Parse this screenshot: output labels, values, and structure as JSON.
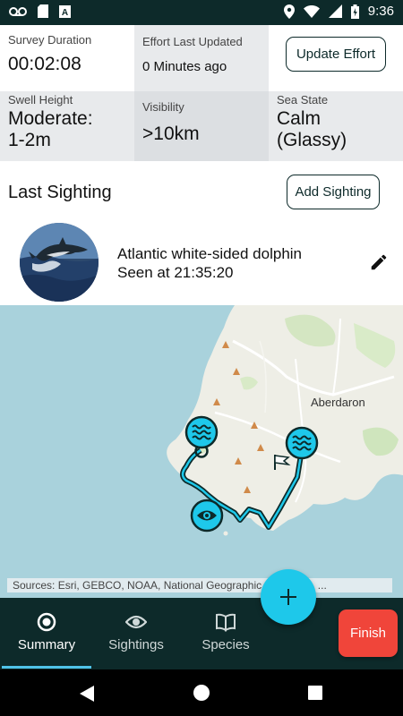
{
  "status_bar": {
    "time": "9:36",
    "left_icons": [
      "voicemail-icon",
      "sd-card-icon",
      "app-notification-icon"
    ],
    "right_icons": [
      "location-icon",
      "wifi-icon",
      "signal-icon",
      "battery-icon"
    ]
  },
  "survey": {
    "duration_label": "Survey Duration",
    "duration_value": "00:02:08",
    "effort_label": "Effort Last Updated",
    "effort_value": "0 Minutes ago",
    "update_button": "Update Effort",
    "swell_label": "Swell Height",
    "swell_value_line1": "Moderate:",
    "swell_value_line2": "1-2m",
    "visibility_label": "Visibility",
    "visibility_value": ">10km",
    "sea_state_label": "Sea State",
    "sea_state_value_line1": "Calm",
    "sea_state_value_line2": "(Glassy)"
  },
  "last_sighting": {
    "title": "Last Sighting",
    "add_button": "Add Sighting",
    "species": "Atlantic white-sided dolphin",
    "seen_at": "Seen at 21:35:20"
  },
  "map": {
    "place_label": "Aberdaron",
    "attribution": "Sources: Esri, GEBCO, NOAA, National Geographic, DeLorme, ..."
  },
  "nav": {
    "items": [
      {
        "label": "Summary",
        "icon": "radio-target-icon"
      },
      {
        "label": "Sightings",
        "icon": "eye-icon"
      },
      {
        "label": "Species",
        "icon": "book-icon"
      }
    ],
    "add_icon": "plus-icon",
    "finish": "Finish"
  },
  "colors": {
    "dark_teal": "#0d2a2a",
    "accent_cyan": "#1ec8ea",
    "finish_red": "#f0453a",
    "sea": "#a9d2dc",
    "land": "#eeeee6"
  }
}
